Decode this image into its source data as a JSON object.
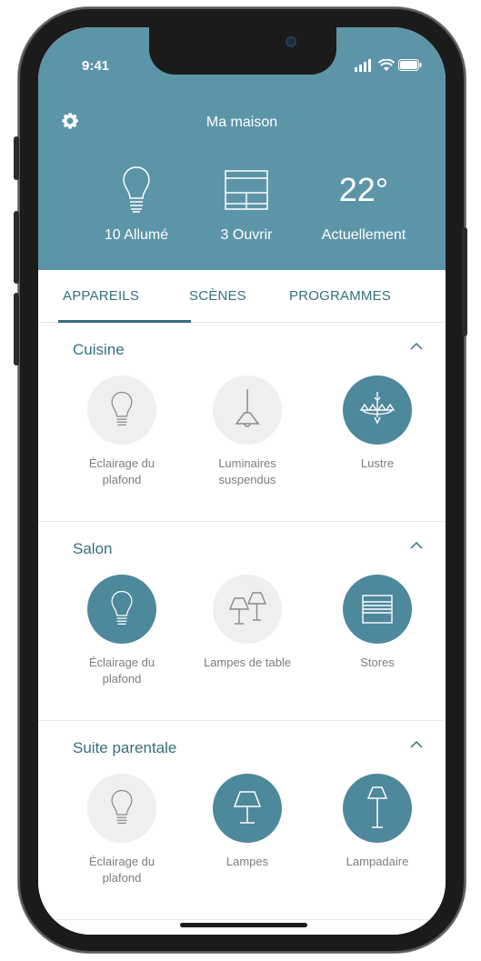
{
  "status_bar": {
    "time": "9:41"
  },
  "header": {
    "title": "Ma maison",
    "stats": [
      {
        "label": "10 Allumé",
        "icon": "bulb-icon"
      },
      {
        "label": "3 Ouvrir",
        "icon": "blinds-icon"
      },
      {
        "value": "22°",
        "label": "Actuellement"
      }
    ]
  },
  "tabs": [
    {
      "label": "APPAREILS",
      "active": true
    },
    {
      "label": "SCÈNES",
      "active": false
    },
    {
      "label": "PROGRAMMES",
      "active": false
    }
  ],
  "sections": [
    {
      "title": "Cuisine",
      "devices": [
        {
          "name": "Éclairage du plafond",
          "icon": "bulb-icon",
          "on": false
        },
        {
          "name": "Luminaires suspendus",
          "icon": "pendant-lamp-icon",
          "on": false
        },
        {
          "name": "Lustre",
          "icon": "chandelier-icon",
          "on": true
        }
      ]
    },
    {
      "title": "Salon",
      "devices": [
        {
          "name": "Éclairage du plafond",
          "icon": "bulb-icon",
          "on": true
        },
        {
          "name": "Lampes de table",
          "icon": "table-lamps-icon",
          "on": false
        },
        {
          "name": "Stores",
          "icon": "blinds-icon",
          "on": true
        }
      ]
    },
    {
      "title": "Suite parentale",
      "devices": [
        {
          "name": "Éclairage du plafond",
          "icon": "bulb-icon",
          "on": false
        },
        {
          "name": "Lampes",
          "icon": "table-lamp-icon",
          "on": true
        },
        {
          "name": "Lampadaire",
          "icon": "floor-lamp-icon",
          "on": true
        }
      ]
    }
  ],
  "colors": {
    "header_bg": "#5d95a8",
    "accent": "#35707f",
    "device_on": "#4e889b",
    "device_off": "#efefef"
  }
}
